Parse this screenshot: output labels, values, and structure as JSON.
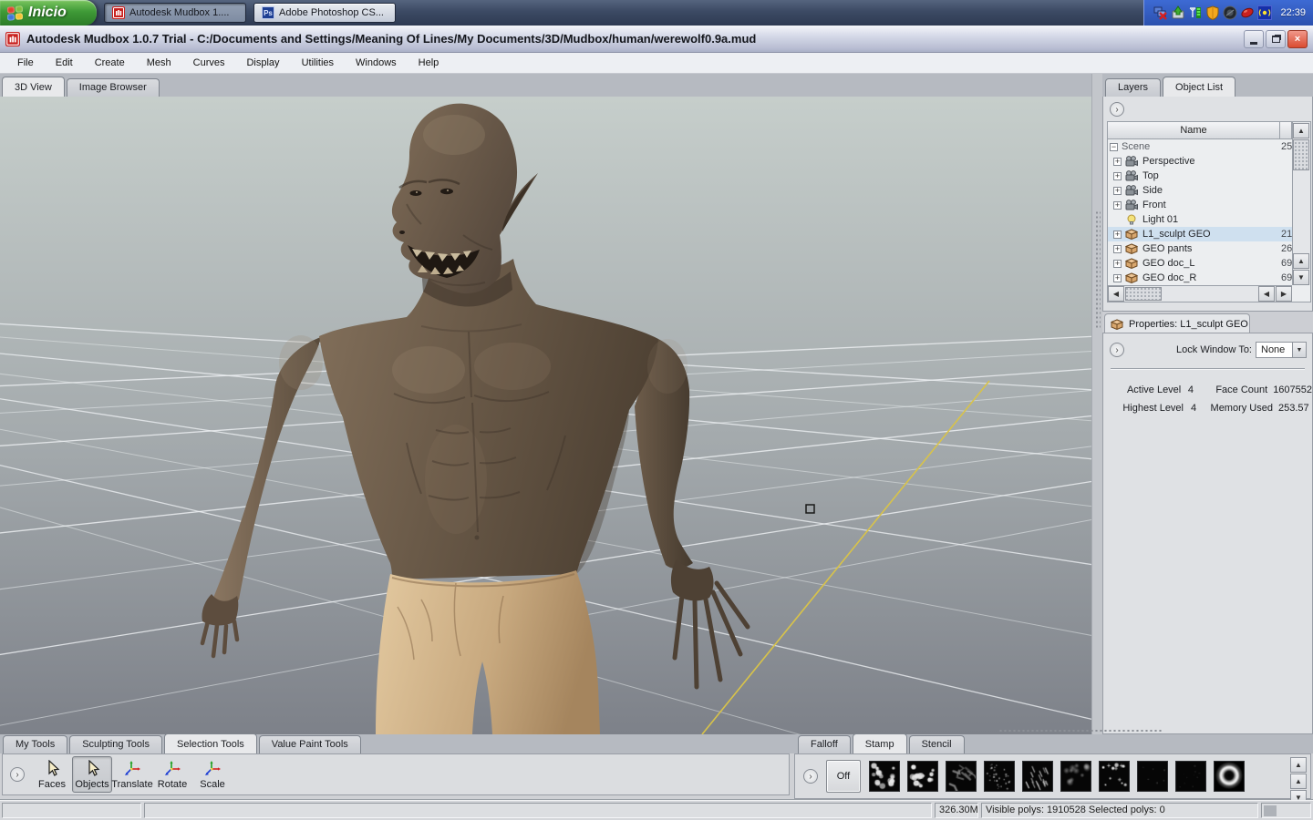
{
  "taskbar": {
    "start_label": "Inicio",
    "windows": [
      {
        "label": "Autodesk Mudbox 1...."
      },
      {
        "label": "Adobe Photoshop CS..."
      }
    ],
    "tray_icons": [
      "network-offline",
      "updates",
      "signal-strength",
      "security-shield",
      "monitor",
      "mouse",
      "wireless"
    ],
    "clock": "22:39"
  },
  "titlebar": {
    "title": "Autodesk Mudbox 1.0.7 Trial - C:/Documents and Settings/Meaning Of Lines/My Documents/3D/Mudbox/human/werewolf0.9a.mud",
    "buttons": {
      "minimize": "",
      "restore": "",
      "close": "×"
    }
  },
  "menu": {
    "items": [
      "File",
      "Edit",
      "Create",
      "Mesh",
      "Curves",
      "Display",
      "Utilities",
      "Windows",
      "Help"
    ]
  },
  "view_tabs": {
    "tabs": [
      "3D View",
      "Image Browser"
    ],
    "active": "3D View"
  },
  "right_panel": {
    "tabs": [
      "Layers",
      "Object List"
    ],
    "active_tab": "Object List",
    "object_list": {
      "header": "Name",
      "rows": [
        {
          "name": "Scene",
          "value": "25",
          "type": "root"
        },
        {
          "name": "Perspective",
          "value": "",
          "type": "camera"
        },
        {
          "name": "Top",
          "value": "",
          "type": "camera"
        },
        {
          "name": "Side",
          "value": "",
          "type": "camera"
        },
        {
          "name": "Front",
          "value": "",
          "type": "camera"
        },
        {
          "name": "Light 01",
          "value": "",
          "type": "light"
        },
        {
          "name": "L1_sculpt GEO",
          "value": "21",
          "type": "geometry",
          "selected": true
        },
        {
          "name": "GEO pants",
          "value": "26",
          "type": "geometry"
        },
        {
          "name": "GEO doc_L",
          "value": "69",
          "type": "geometry"
        },
        {
          "name": "GEO doc_R",
          "value": "69",
          "type": "geometry"
        }
      ]
    },
    "properties": {
      "title": "Properties: L1_sculpt GEO",
      "lock_label": "Lock Window To:",
      "lock_value": "None",
      "stats": {
        "active_level_label": "Active Level",
        "active_level": "4",
        "face_count_label": "Face Count",
        "face_count": "1607552",
        "highest_level_label": "Highest Level",
        "highest_level": "4",
        "memory_used_label": "Memory Used",
        "memory_used": "253.57"
      }
    }
  },
  "tools_panel": {
    "tabs": [
      "My Tools",
      "Sculpting Tools",
      "Selection Tools",
      "Value Paint Tools"
    ],
    "active_tab": "Selection Tools",
    "buttons": [
      {
        "label": "Faces",
        "icon": "cursor"
      },
      {
        "label": "Objects",
        "icon": "cursor",
        "selected": true
      },
      {
        "label": "Translate",
        "icon": "axis-tripod"
      },
      {
        "label": "Rotate",
        "icon": "axis-tripod"
      },
      {
        "label": "Scale",
        "icon": "axis-tripod"
      }
    ]
  },
  "stamp_panel": {
    "tabs": [
      "Falloff",
      "Stamp",
      "Stencil"
    ],
    "active_tab": "Stamp",
    "off_label": "Off",
    "stamps": [
      {
        "name": "stamp-blobs-1",
        "pattern": "blobs1"
      },
      {
        "name": "stamp-blobs-2",
        "pattern": "blobs2"
      },
      {
        "name": "stamp-scratches",
        "pattern": "scratches"
      },
      {
        "name": "stamp-speckle",
        "pattern": "speckle"
      },
      {
        "name": "stamp-dashes",
        "pattern": "dashes"
      },
      {
        "name": "stamp-soft-dots",
        "pattern": "softdots"
      },
      {
        "name": "stamp-splatter",
        "pattern": "splatter"
      },
      {
        "name": "stamp-dark",
        "pattern": "dark"
      },
      {
        "name": "stamp-faint-dots",
        "pattern": "faint"
      },
      {
        "name": "stamp-ring",
        "pattern": "ring"
      }
    ]
  },
  "status_bar": {
    "memory": "326.30M",
    "poly_info": "Visible polys: 1910528  Selected polys: 0"
  },
  "colors": {
    "selection_highlight": "#cfe0ef",
    "close_button": "#da4b31",
    "viewport_top": "#c6cecb",
    "viewport_bottom": "#7d8189",
    "axis_line": "#d8c349",
    "mudbox_red": "#c8211e"
  }
}
